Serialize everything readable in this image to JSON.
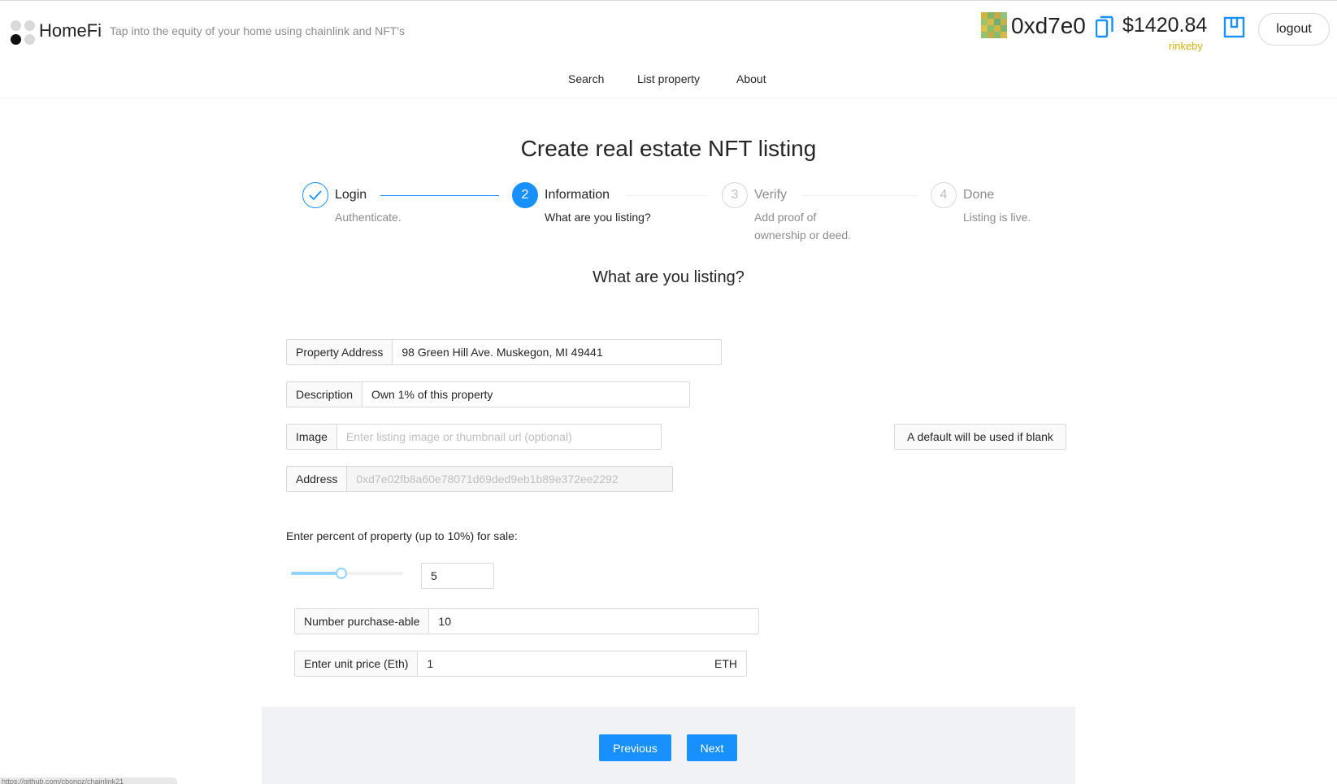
{
  "app": {
    "brand": "HomeFi",
    "tagline": "Tap into the equity of your home using chainlink and NFT's"
  },
  "account": {
    "short_address": "0xd7e0",
    "balance": "$1420.84",
    "network": "rinkeby",
    "logout_label": "logout",
    "avatar_colors": [
      "#d4b33a",
      "#7fb86a",
      "#c9a847",
      "#8fc27a",
      "#9ac46e",
      "#d9b84a",
      "#6fae73",
      "#c8b14d",
      "#e0c04c",
      "#86bf70",
      "#d2b643",
      "#7db46c",
      "#94c172",
      "#c5ad46",
      "#88bc6d",
      "#dab84b"
    ]
  },
  "nav": {
    "search": "Search",
    "list_property": "List property",
    "about": "About"
  },
  "page": {
    "title": "Create real estate NFT listing",
    "subtitle": "What are you listing?"
  },
  "steps": [
    {
      "title": "Login",
      "desc": "Authenticate.",
      "status": "finish"
    },
    {
      "number": "2",
      "title": "Information",
      "desc": "What are you listing?",
      "status": "process"
    },
    {
      "number": "3",
      "title": "Verify",
      "desc_line1": "Add proof of",
      "desc_line2": "ownership or deed.",
      "status": "wait"
    },
    {
      "number": "4",
      "title": "Done",
      "desc": "Listing is live.",
      "status": "wait"
    }
  ],
  "form": {
    "property_address": {
      "label": "Property Address",
      "value": "98 Green Hill Ave. Muskegon, MI 49441"
    },
    "description": {
      "label": "Description",
      "value": "Own 1% of this property"
    },
    "image": {
      "label": "Image",
      "placeholder": "Enter listing image or thumbnail url (optional)",
      "value": ""
    },
    "image_note": "A default will be used if blank",
    "address": {
      "label": "Address",
      "value": "0xd7e02fb8a60e78071d69ded9eb1b89e372ee2292"
    },
    "percent_label": "Enter percent of property (up to 10%) for sale:",
    "percent_value": "5",
    "percent_max": 10,
    "number_purchaseable": {
      "label": "Number purchase-able",
      "value": "10"
    },
    "unit_price": {
      "label": "Enter unit price (Eth)",
      "value": "1",
      "suffix": "ETH"
    }
  },
  "actions": {
    "previous": "Previous",
    "next": "Next"
  },
  "status_bar": "https://github.com/cbonoz/chainlink21",
  "colors": {
    "primary": "#1890ff",
    "network": "#d6b214",
    "slider": "#91d5ff"
  }
}
